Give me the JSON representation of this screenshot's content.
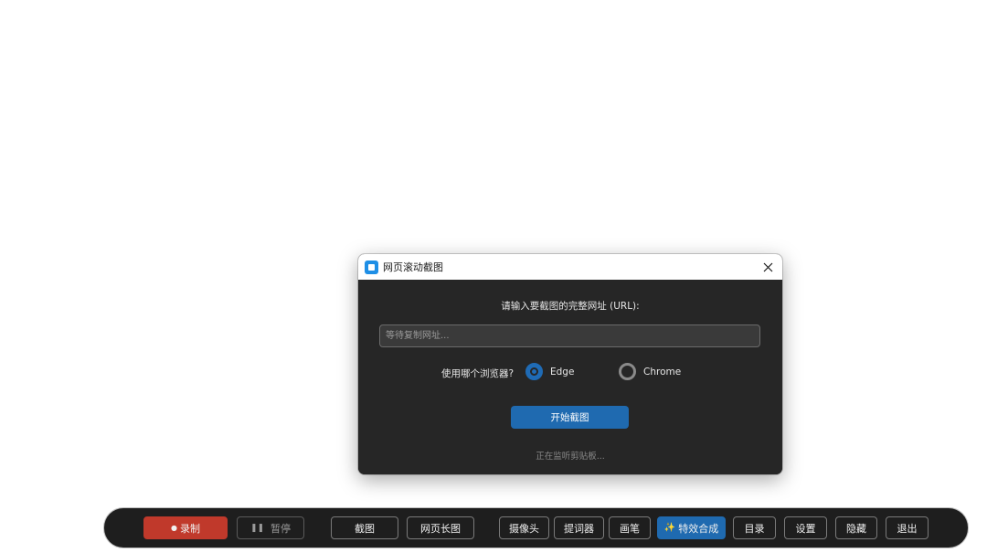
{
  "dialog": {
    "title": "网页滚动截图",
    "prompt": "请输入要截图的完整网址 (URL):",
    "url_placeholder": "等待复制网址...",
    "browser_label": "使用哪个浏览器?",
    "browsers": [
      {
        "label": "Edge",
        "selected": true
      },
      {
        "label": "Chrome",
        "selected": false
      }
    ],
    "start_button": "开始截图",
    "status": "正在监听剪贴板..."
  },
  "toolbar": {
    "record": {
      "icon": "●",
      "label": "录制"
    },
    "pause": {
      "icon": "❚❚",
      "label": "暂停"
    },
    "screenshot": "截图",
    "long_screenshot": "网页长图",
    "camera": "摄像头",
    "teleprompter": "提词器",
    "pen": "画笔",
    "effects": {
      "icon": "✨",
      "label": "特效合成"
    },
    "catalog": "目录",
    "settings": "设置",
    "hide": "隐藏",
    "exit": "退出"
  },
  "colors": {
    "accent": "#1f6ab0",
    "record": "#c0392b",
    "dialog_bg": "#262626",
    "toolbar_bg": "#1e1e1e"
  }
}
